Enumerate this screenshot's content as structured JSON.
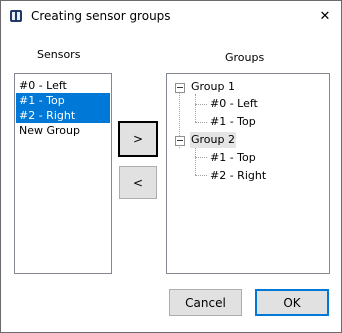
{
  "window": {
    "title": "Creating sensor groups",
    "close_glyph": "✕"
  },
  "sensors": {
    "label": "Sensors",
    "items": [
      {
        "label": "#0 - Left",
        "selected": false
      },
      {
        "label": "#1 - Top",
        "selected": true
      },
      {
        "label": "#2 - Right",
        "selected": true
      },
      {
        "label": "New Group",
        "selected": false
      }
    ]
  },
  "groups": {
    "label": "Groups",
    "tree": [
      {
        "label": "Group 1",
        "expanded": true,
        "children": [
          "#0 - Left",
          "#1 - Top"
        ]
      },
      {
        "label": "Group 2",
        "expanded": true,
        "highlighted": true,
        "children": [
          "#1 - Top",
          "#2 - Right"
        ]
      }
    ]
  },
  "buttons": {
    "move_right": ">",
    "move_left": "<",
    "cancel": "Cancel",
    "ok": "OK"
  },
  "colors": {
    "selection": "#0078d7",
    "button_face": "#e1e1e1"
  }
}
